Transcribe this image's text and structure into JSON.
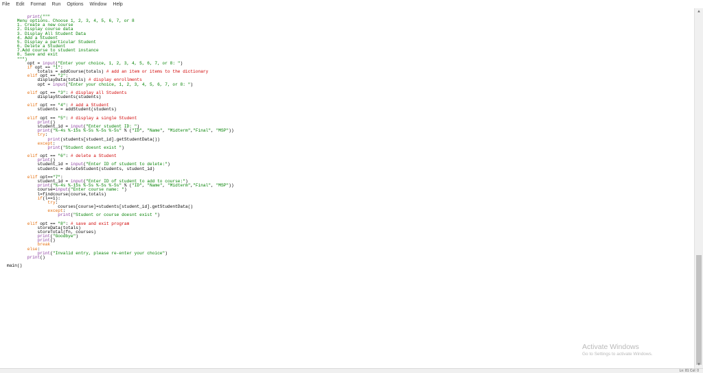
{
  "menu": [
    "File",
    "Edit",
    "Format",
    "Run",
    "Options",
    "Window",
    "Help"
  ],
  "code_lines": [
    [
      {
        "t": "        "
      },
      {
        "t": "print",
        "c": "bi"
      },
      {
        "t": "(\"\"\"",
        "c": "str"
      }
    ],
    [
      {
        "t": "    Menu options. Choose 1, 2, 3, 4, 5, 6, 7, or 8",
        "c": "str"
      }
    ],
    [
      {
        "t": "    1. Create a new course",
        "c": "str"
      }
    ],
    [
      {
        "t": "    2. Display course data",
        "c": "str"
      }
    ],
    [
      {
        "t": "    3. Display All Student Data",
        "c": "str"
      }
    ],
    [
      {
        "t": "    4. Add a Student",
        "c": "str"
      }
    ],
    [
      {
        "t": "    5. Display a particular Student",
        "c": "str"
      }
    ],
    [
      {
        "t": "    6. Delete a Student",
        "c": "str"
      }
    ],
    [
      {
        "t": "    7.Add course to student instance",
        "c": "str"
      }
    ],
    [
      {
        "t": "    8. Save and exit",
        "c": "str"
      }
    ],
    [
      {
        "t": "    \"\"\")",
        "c": "str"
      }
    ],
    [
      {
        "t": "        opt = "
      },
      {
        "t": "input",
        "c": "bi"
      },
      {
        "t": "("
      },
      {
        "t": "\"Enter your choice, 1, 2, 3, 4, 5, 6, 7, or 8: \"",
        "c": "str"
      },
      {
        "t": ")"
      }
    ],
    [
      {
        "t": "        "
      },
      {
        "t": "if",
        "c": "kw"
      },
      {
        "t": " opt == "
      },
      {
        "t": "\"1\"",
        "c": "str"
      },
      {
        "t": ":"
      }
    ],
    [
      {
        "t": "            totals = addCourse(totals) "
      },
      {
        "t": "# add an item or items to the dictionary",
        "c": "cmt"
      }
    ],
    [
      {
        "t": "        "
      },
      {
        "t": "elif",
        "c": "kw"
      },
      {
        "t": " opt == "
      },
      {
        "t": "\"2\"",
        "c": "str"
      },
      {
        "t": ":"
      }
    ],
    [
      {
        "t": "            displayData(totals) "
      },
      {
        "t": "# display enrollments",
        "c": "cmt"
      }
    ],
    [
      {
        "t": "            opt = "
      },
      {
        "t": "input",
        "c": "bi"
      },
      {
        "t": "("
      },
      {
        "t": "\"Enter your choice, 1, 2, 3, 4, 5, 6, 7, or 8: \"",
        "c": "str"
      },
      {
        "t": ")"
      }
    ],
    [
      {
        "t": ""
      }
    ],
    [
      {
        "t": "        "
      },
      {
        "t": "elif",
        "c": "kw"
      },
      {
        "t": " opt == "
      },
      {
        "t": "\"3\"",
        "c": "str"
      },
      {
        "t": ": "
      },
      {
        "t": "# display all Students",
        "c": "cmt"
      }
    ],
    [
      {
        "t": "            displayStudents(students)"
      }
    ],
    [
      {
        "t": ""
      }
    ],
    [
      {
        "t": "        "
      },
      {
        "t": "elif",
        "c": "kw"
      },
      {
        "t": " opt == "
      },
      {
        "t": "\"4\"",
        "c": "str"
      },
      {
        "t": ": "
      },
      {
        "t": "# add a Student",
        "c": "cmt"
      }
    ],
    [
      {
        "t": "            students = addStudent(students)"
      }
    ],
    [
      {
        "t": ""
      }
    ],
    [
      {
        "t": "        "
      },
      {
        "t": "elif",
        "c": "kw"
      },
      {
        "t": " opt == "
      },
      {
        "t": "\"5\"",
        "c": "str"
      },
      {
        "t": ": "
      },
      {
        "t": "# display a single Student",
        "c": "cmt"
      }
    ],
    [
      {
        "t": "            "
      },
      {
        "t": "print",
        "c": "bi"
      },
      {
        "t": "()"
      }
    ],
    [
      {
        "t": "            student_id = "
      },
      {
        "t": "input",
        "c": "bi"
      },
      {
        "t": "("
      },
      {
        "t": "\"Enter student ID: \"",
        "c": "str"
      },
      {
        "t": ")"
      }
    ],
    [
      {
        "t": "            "
      },
      {
        "t": "print",
        "c": "bi"
      },
      {
        "t": "("
      },
      {
        "t": "\"%-4s %-15s %-5s %-5s %-5s\"",
        "c": "str"
      },
      {
        "t": " % ("
      },
      {
        "t": "\"ID\"",
        "c": "str"
      },
      {
        "t": ", "
      },
      {
        "t": "\"Name\"",
        "c": "str"
      },
      {
        "t": ", "
      },
      {
        "t": "\"Midterm\"",
        "c": "str"
      },
      {
        "t": ","
      },
      {
        "t": "\"Final\"",
        "c": "str"
      },
      {
        "t": ", "
      },
      {
        "t": "\"MSP\"",
        "c": "str"
      },
      {
        "t": "))"
      }
    ],
    [
      {
        "t": "            "
      },
      {
        "t": "try",
        "c": "kw"
      },
      {
        "t": ":"
      }
    ],
    [
      {
        "t": "                "
      },
      {
        "t": "print",
        "c": "bi"
      },
      {
        "t": "(students[student_id].getStudentData())"
      }
    ],
    [
      {
        "t": "            "
      },
      {
        "t": "except",
        "c": "kw"
      },
      {
        "t": ":"
      }
    ],
    [
      {
        "t": "                "
      },
      {
        "t": "print",
        "c": "bi"
      },
      {
        "t": "("
      },
      {
        "t": "\"Student doesnt exist \"",
        "c": "str"
      },
      {
        "t": ")"
      }
    ],
    [
      {
        "t": ""
      }
    ],
    [
      {
        "t": "        "
      },
      {
        "t": "elif",
        "c": "kw"
      },
      {
        "t": " opt == "
      },
      {
        "t": "\"6\"",
        "c": "str"
      },
      {
        "t": ": "
      },
      {
        "t": "# delete a Student",
        "c": "cmt"
      }
    ],
    [
      {
        "t": "            "
      },
      {
        "t": "print",
        "c": "bi"
      },
      {
        "t": "()"
      }
    ],
    [
      {
        "t": "            student_id = "
      },
      {
        "t": "input",
        "c": "bi"
      },
      {
        "t": "("
      },
      {
        "t": "\"Enter ID of student to delete:\"",
        "c": "str"
      },
      {
        "t": ")"
      }
    ],
    [
      {
        "t": "            students = deleteStudent(students, student_id)"
      }
    ],
    [
      {
        "t": ""
      }
    ],
    [
      {
        "t": "        "
      },
      {
        "t": "elif",
        "c": "kw"
      },
      {
        "t": " opt=="
      },
      {
        "t": "\"7\"",
        "c": "str"
      },
      {
        "t": ":"
      }
    ],
    [
      {
        "t": "            student_id = "
      },
      {
        "t": "input",
        "c": "bi"
      },
      {
        "t": "("
      },
      {
        "t": "\"Enter ID of student to add to course:\"",
        "c": "str"
      },
      {
        "t": ")"
      }
    ],
    [
      {
        "t": "            "
      },
      {
        "t": "print",
        "c": "bi"
      },
      {
        "t": "("
      },
      {
        "t": "\"%-4s %-15s %-5s %-5s %-5s\"",
        "c": "str"
      },
      {
        "t": " % ("
      },
      {
        "t": "\"ID\"",
        "c": "str"
      },
      {
        "t": ", "
      },
      {
        "t": "\"Name\"",
        "c": "str"
      },
      {
        "t": ", "
      },
      {
        "t": "\"Midterm\"",
        "c": "str"
      },
      {
        "t": ","
      },
      {
        "t": "\"Final\"",
        "c": "str"
      },
      {
        "t": ", "
      },
      {
        "t": "\"MSP\"",
        "c": "str"
      },
      {
        "t": "))"
      }
    ],
    [
      {
        "t": "            course="
      },
      {
        "t": "input",
        "c": "bi"
      },
      {
        "t": "("
      },
      {
        "t": "\"Enter course name: \"",
        "c": "str"
      },
      {
        "t": ")"
      }
    ],
    [
      {
        "t": "            l=findcourse(course,totals)"
      }
    ],
    [
      {
        "t": "            "
      },
      {
        "t": "if",
        "c": "kw"
      },
      {
        "t": "(l==1):"
      }
    ],
    [
      {
        "t": "                "
      },
      {
        "t": "try",
        "c": "kw"
      },
      {
        "t": ":"
      }
    ],
    [
      {
        "t": "                    courses[course]=students[student_id].getStudentData()"
      }
    ],
    [
      {
        "t": "                "
      },
      {
        "t": "except",
        "c": "kw"
      },
      {
        "t": ":"
      }
    ],
    [
      {
        "t": "                    "
      },
      {
        "t": "print",
        "c": "bi"
      },
      {
        "t": "("
      },
      {
        "t": "\"Student or course doesnt exist \"",
        "c": "str"
      },
      {
        "t": ")"
      }
    ],
    [
      {
        "t": ""
      }
    ],
    [
      {
        "t": "        "
      },
      {
        "t": "elif",
        "c": "kw"
      },
      {
        "t": " opt == "
      },
      {
        "t": "\"8\"",
        "c": "str"
      },
      {
        "t": ": "
      },
      {
        "t": "# save and exit program",
        "c": "cmt"
      }
    ],
    [
      {
        "t": "            storeData(totals)"
      }
    ],
    [
      {
        "t": "            storeTotal(fn, courses)"
      }
    ],
    [
      {
        "t": "            "
      },
      {
        "t": "print",
        "c": "bi"
      },
      {
        "t": "("
      },
      {
        "t": "\"Goodbye\"",
        "c": "str"
      },
      {
        "t": ")"
      }
    ],
    [
      {
        "t": "            "
      },
      {
        "t": "print",
        "c": "bi"
      },
      {
        "t": "()"
      }
    ],
    [
      {
        "t": "            "
      },
      {
        "t": "break",
        "c": "kw"
      }
    ],
    [
      {
        "t": "        "
      },
      {
        "t": "else",
        "c": "kw"
      },
      {
        "t": ":"
      }
    ],
    [
      {
        "t": "            "
      },
      {
        "t": "print",
        "c": "bi"
      },
      {
        "t": "("
      },
      {
        "t": "\"Invalid entry, please re-enter your choice\"",
        "c": "str"
      },
      {
        "t": ")"
      }
    ],
    [
      {
        "t": "        "
      },
      {
        "t": "print",
        "c": "bi"
      },
      {
        "t": "()"
      }
    ],
    [
      {
        "t": ""
      }
    ],
    [
      {
        "t": "main()"
      }
    ]
  ],
  "watermark": {
    "title": "Activate Windows",
    "subtitle": "Go to Settings to activate Windows."
  },
  "status": "Ln: 81 Col: 0",
  "colors": {
    "keyword": "#e46c0a",
    "string": "#008000",
    "comment": "#d00000",
    "builtin": "#8b3fa0"
  }
}
